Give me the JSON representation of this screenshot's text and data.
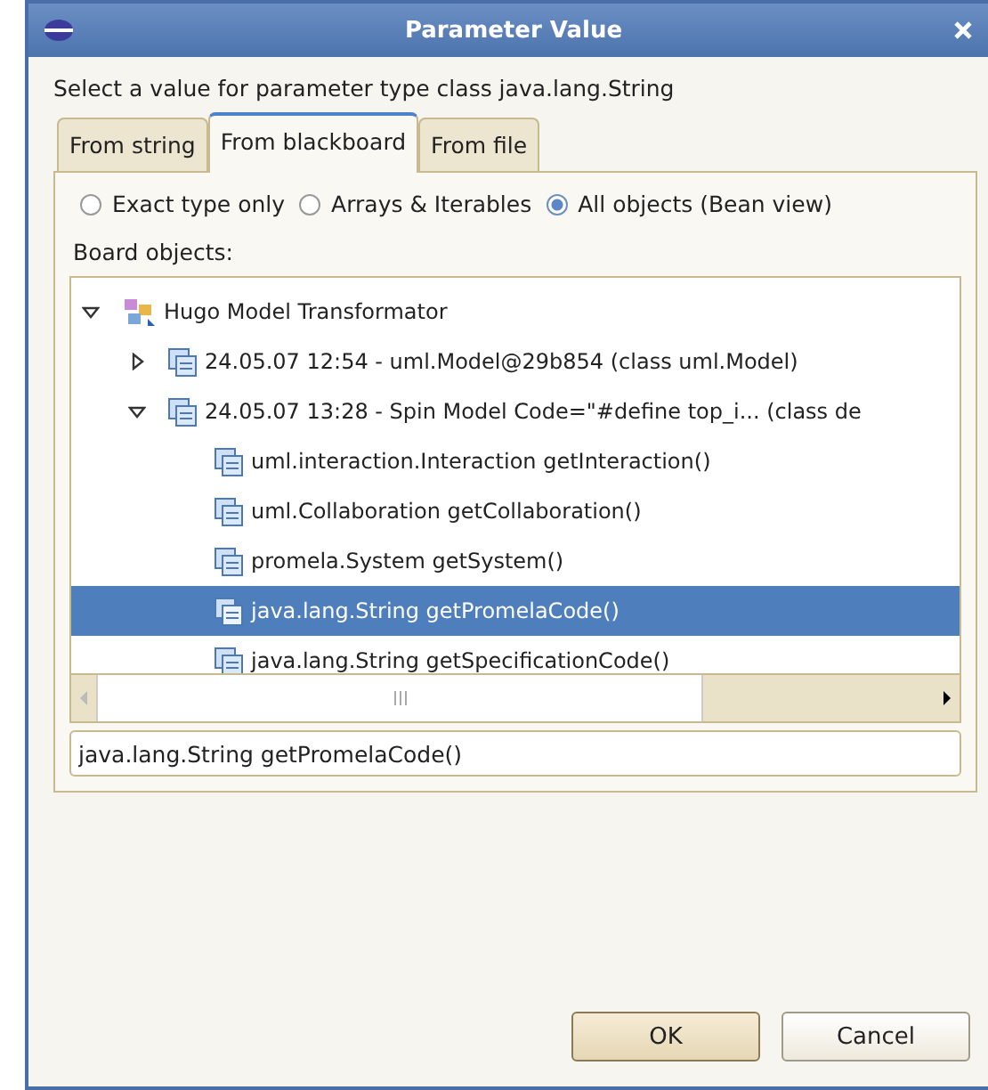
{
  "window": {
    "title": "Parameter Value"
  },
  "prompt": "Select a value for parameter type class java.lang.String",
  "tabs": [
    {
      "label": "From string",
      "selected": false
    },
    {
      "label": "From blackboard",
      "selected": true
    },
    {
      "label": "From file",
      "selected": false
    }
  ],
  "filters": [
    {
      "label": "Exact type only",
      "selected": false
    },
    {
      "label": "Arrays & Iterables",
      "selected": false
    },
    {
      "label": "All objects (Bean view)",
      "selected": true
    }
  ],
  "tree_label": "Board objects:",
  "tree": [
    {
      "label": "Hugo Model Transformator",
      "kind": "root",
      "expanded": true,
      "selected": false,
      "children": [
        {
          "label": "24.05.07 12:54 - uml.Model@29b854 (class uml.Model)",
          "kind": "object",
          "expanded": false,
          "selected": false
        },
        {
          "label": "24.05.07 13:28 - Spin Model Code=\"#define top_i... (class de",
          "kind": "object",
          "expanded": true,
          "selected": false,
          "children": [
            {
              "label": "uml.interaction.Interaction getInteraction()",
              "kind": "method",
              "selected": false
            },
            {
              "label": "uml.Collaboration getCollaboration()",
              "kind": "method",
              "selected": false
            },
            {
              "label": "promela.System getSystem()",
              "kind": "method",
              "selected": false
            },
            {
              "label": "java.lang.String getPromelaCode()",
              "kind": "method",
              "selected": true
            },
            {
              "label": "java.lang.String getSpecificationCode()",
              "kind": "method",
              "selected": false
            }
          ]
        }
      ]
    }
  ],
  "value": "java.lang.String getPromelaCode()",
  "buttons": [
    "OK",
    "Cancel"
  ]
}
